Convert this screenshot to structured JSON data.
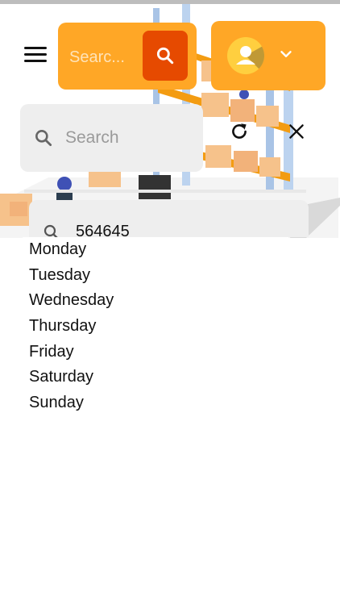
{
  "header": {
    "menu_icon": "hamburger-menu-icon",
    "search_placeholder": "Searc...",
    "search_button_icon": "search-icon",
    "avatar_icon": "user-avatar-icon",
    "dropdown_icon": "chevron-down-icon"
  },
  "filter": {
    "search_placeholder": "Search",
    "search_icon": "search-icon",
    "refresh_icon": "refresh-icon",
    "close_icon": "close-icon"
  },
  "autocomplete": {
    "query": "564645",
    "search_icon": "search-icon"
  },
  "days": [
    "Monday",
    "Tuesday",
    "Wednesday",
    "Thursday",
    "Friday",
    "Saturday",
    "Sunday"
  ],
  "colors": {
    "accent": "#ffa726",
    "accent_dark": "#e64a00",
    "field_bg": "#eeeeee"
  }
}
